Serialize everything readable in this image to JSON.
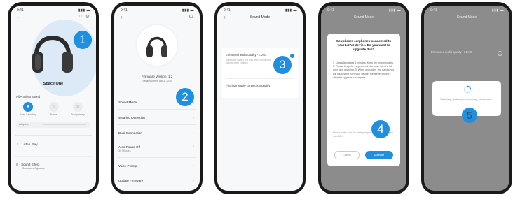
{
  "status": {
    "time": "9:41",
    "signal": "▮▮▮ ▬"
  },
  "badges": [
    "1",
    "2",
    "3",
    "4",
    "5"
  ],
  "phone1": {
    "back": "←",
    "icons": [
      "○",
      "⚙"
    ],
    "device_name": "Space One",
    "mode_title": "All Ambient Sound",
    "modes": [
      {
        "icon": "●",
        "label": "Noise Cancelling",
        "active": true
      },
      {
        "icon": "○",
        "label": "Normal",
        "active": false
      },
      {
        "icon": "◎",
        "label": "Transparency",
        "active": false
      }
    ],
    "slider_label": "Adaptive",
    "list": [
      {
        "icon": "♫",
        "label": "Listen Play"
      },
      {
        "icon": "≡",
        "label": "Sound Effect",
        "sub": "Soundcore Signature"
      }
    ]
  },
  "phone2": {
    "back": "‹",
    "headset_icon": "☊",
    "fw_title": "Firmware Version: 1.2",
    "fw_sub": "Serial Number: ABCD 1234",
    "rows": [
      {
        "label": "Sound Mode"
      },
      {
        "label": "Wearing Detection"
      },
      {
        "label": "Dual Connection"
      },
      {
        "label": "Auto Power Off",
        "sub": "30 Minutes"
      },
      {
        "label": "Voice Prompt"
      },
      {
        "label": "Update Firmware"
      }
    ]
  },
  "phone3": {
    "title": "Sound Mode",
    "option1": "Enhanced audio quality - LDAC",
    "option1_sub": "Uses more battery and may affect connection stability when enabled.",
    "option2": "Prioritize stable connection quality"
  },
  "phone4": {
    "title": "Sound Mode",
    "dialog_title": "Soundcore earphones connected to your LDAC device. Do you want to upgrade this?",
    "dialog_body": "1. Upgrading takes 3 minutes. Keep the phone nearby. 2. Please keep the earphones in the case with the lid open and charging. 3. When upgrading, the earphones will disconnect from your device. Please reconnect after the upgrade is complete.",
    "note": "Please make sure the battery of your earphones is higher than 30%.",
    "cancel": "Cancel",
    "confirm": "Upgrade"
  },
  "phone5": {
    "title": "Sound Mode",
    "option1": "Enhanced audio quality - LDAC",
    "loading_text": "Switching modes and connecting, please wait..."
  }
}
